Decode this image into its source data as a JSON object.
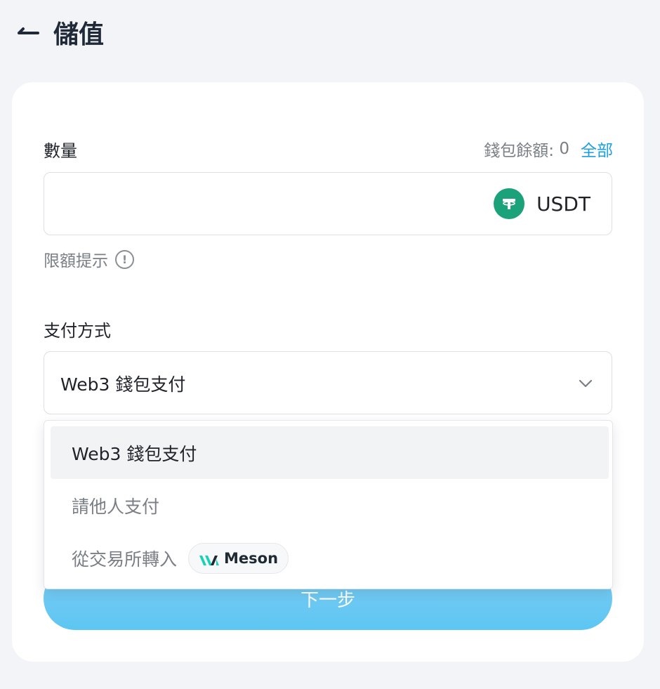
{
  "header": {
    "title": "儲值"
  },
  "amount": {
    "label": "數量",
    "balance_label": "錢包餘額:",
    "balance_value": "0",
    "all_link": "全部",
    "value": "",
    "token": {
      "name": "USDT",
      "icon": "usdt-tether-icon",
      "color": "#1ba27a"
    }
  },
  "limit_hint": {
    "label": "限額提示",
    "icon": "info-icon"
  },
  "payment": {
    "label": "支付方式",
    "selected": "Web3 錢包支付",
    "options": [
      {
        "label": "Web3 錢包支付",
        "active": true
      },
      {
        "label": "請他人支付",
        "active": false
      },
      {
        "label": "從交易所轉入",
        "active": false,
        "badge": "Meson"
      }
    ]
  },
  "next_button": {
    "label": "下一步"
  },
  "colors": {
    "accent": "#1aa0e0",
    "button": "#5dc6f2",
    "background": "#f2f4f8"
  }
}
